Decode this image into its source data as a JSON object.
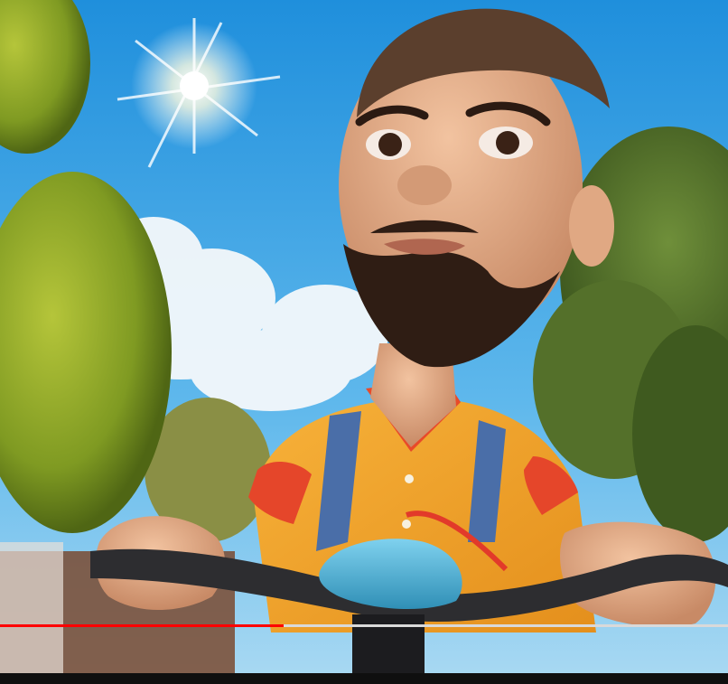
{
  "player": {
    "progress_fraction": 0.39,
    "accent_color": "#ff0000",
    "track_color": "#d9d9d9",
    "scene": {
      "sky_color": "#3fa6e6",
      "shirt_color": "#f2a22a",
      "bike_color": "#4db3d6"
    }
  }
}
